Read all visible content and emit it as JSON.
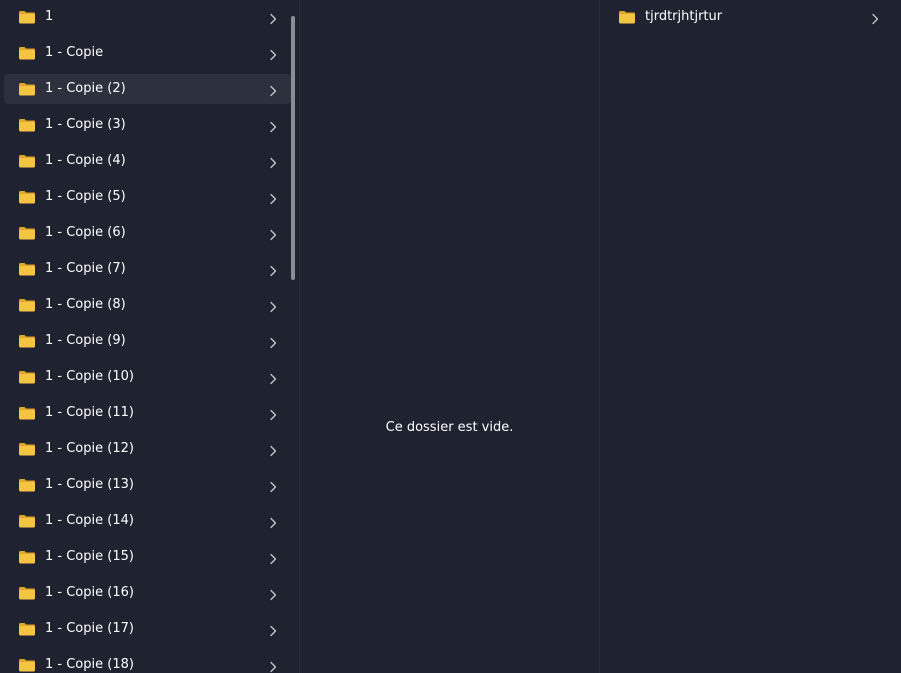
{
  "column1": {
    "items": [
      {
        "label": "1",
        "selected": false
      },
      {
        "label": "1 - Copie",
        "selected": false
      },
      {
        "label": "1 - Copie (2)",
        "selected": true
      },
      {
        "label": "1 - Copie (3)",
        "selected": false
      },
      {
        "label": "1 - Copie (4)",
        "selected": false
      },
      {
        "label": "1 - Copie (5)",
        "selected": false
      },
      {
        "label": "1 - Copie (6)",
        "selected": false
      },
      {
        "label": "1 - Copie (7)",
        "selected": false
      },
      {
        "label": "1 - Copie (8)",
        "selected": false
      },
      {
        "label": "1 - Copie (9)",
        "selected": false
      },
      {
        "label": "1 - Copie (10)",
        "selected": false
      },
      {
        "label": "1 - Copie (11)",
        "selected": false
      },
      {
        "label": "1 - Copie (12)",
        "selected": false
      },
      {
        "label": "1 - Copie (13)",
        "selected": false
      },
      {
        "label": "1 - Copie (14)",
        "selected": false
      },
      {
        "label": "1 - Copie (15)",
        "selected": false
      },
      {
        "label": "1 - Copie (16)",
        "selected": false
      },
      {
        "label": "1 - Copie (17)",
        "selected": false
      },
      {
        "label": "1 - Copie (18)",
        "selected": false
      }
    ]
  },
  "column2": {
    "empty_message": "Ce dossier est vide."
  },
  "column3": {
    "items": [
      {
        "label": "tjrdtrjhtjrtur",
        "selected": false
      }
    ]
  },
  "icons": {
    "folder": "folder-icon",
    "chevron": "chevron-right-icon"
  },
  "colors": {
    "background": "#1f2330",
    "selected_row": "#2d313d",
    "folder_body": "#f5c542",
    "folder_tab": "#e0a92b",
    "chevron": "#c7c9ce",
    "scrollbar": "#8a8d95"
  }
}
